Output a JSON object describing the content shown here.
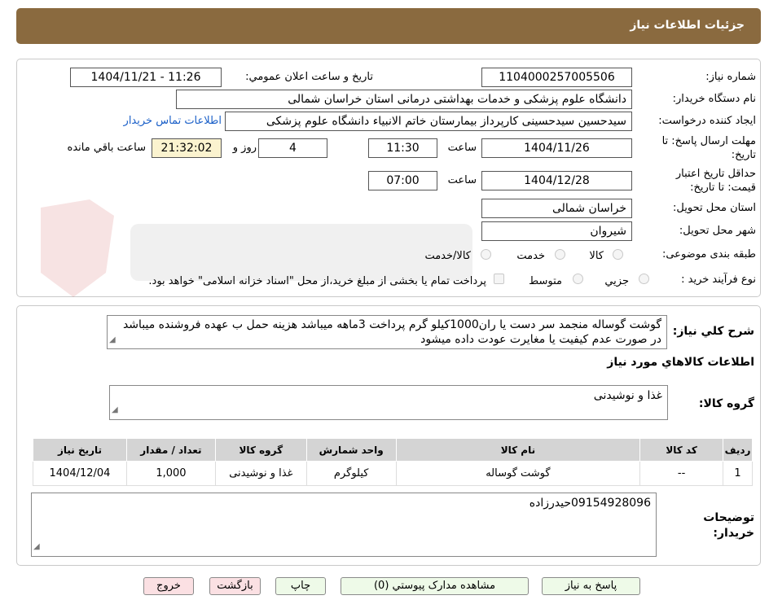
{
  "header": {
    "title": "جزئیات اطلاعات نیاز"
  },
  "form": {
    "need_number_label": "شماره نیاز:",
    "need_number": "1104000257005506",
    "announce_label": "تاریخ و ساعت اعلان عمومي:",
    "announce_value": "1404/11/21 - 11:26",
    "buyer_org_label": "نام دستگاه خریدار:",
    "buyer_org": "دانشگاه علوم پزشکی و خدمات بهداشتی درمانی استان خراسان شمالی",
    "requester_label": "ایجاد کننده درخواست:",
    "requester": "سیدحسین سیدحسینی کارپرداز بیمارستان خاتم الانبیاء دانشگاه علوم پزشکی",
    "contact_link": "اطلاعات تماس خریدار",
    "deadline_label_1": "مهلت ارسال پاسخ: تا",
    "deadline_label_2": "تاریخ:",
    "deadline_date": "1404/11/26",
    "time_label": "ساعت",
    "deadline_time": "11:30",
    "days_value": "4",
    "days_label": "روز و",
    "remaining_time": "21:32:02",
    "remaining_label": "ساعت باقي مانده",
    "validity_label_1": "حداقل تاریخ اعتبار",
    "validity_label_2": "قیمت: تا تاریخ:",
    "validity_date": "1404/12/28",
    "validity_time_label": "ساعت",
    "validity_time": "07:00",
    "province_label": "استان محل تحویل:",
    "province": "خراسان شمالی",
    "city_label": "شهر محل تحویل:",
    "city": "شیروان",
    "category_label": "طبقه بندی موضوعی:",
    "category_options": [
      "کالا",
      "خدمت",
      "کالا/خدمت"
    ],
    "process_label": "نوع فرآیند خرید :",
    "process_options": [
      "جزیي",
      "متوسط"
    ],
    "payment_note": "پرداخت تمام یا بخشی از مبلغ خرید،از محل \"اسناد خزانه اسلامی\" خواهد بود."
  },
  "description": {
    "label": "شرح کلي نياز:",
    "text": "گوشت گوساله منجمد سر دست یا ران1000کیلو گرم پرداخت 3ماهه میباشد هزینه حمل ب عهده فروشنده میباشد در صورت عدم کیفیت یا مغایرت عودت داده میشود"
  },
  "goods": {
    "title": "اطلاعات کالاهاي مورد نياز",
    "group_label": "گروه کالا:",
    "group_value": "غذا و نوشیدنی",
    "columns": [
      "رديف",
      "کد کالا",
      "نام کالا",
      "واحد شمارش",
      "گروه کالا",
      "تعداد / مقدار",
      "تاریخ نیاز"
    ],
    "rows": [
      [
        "1",
        "--",
        "گوشت گوساله",
        "کیلوگرم",
        "غذا و نوشیدنی",
        "1,000",
        "1404/12/04"
      ]
    ]
  },
  "buyer_notes": {
    "label_1": "توضیحات",
    "label_2": "خریدار:",
    "text": "09154928096حیدرزاده"
  },
  "buttons": {
    "reply": "پاسخ به نیاز",
    "view_docs": "مشاهده مدارک پیوستي (0)",
    "print": "چاپ",
    "back": "بازگشت",
    "exit": "خروج"
  },
  "colors": {
    "header_bg": "#8a6a3f",
    "green_button": "#eefae8",
    "pink_button": "#fbe0e3",
    "remaining_bg": "#fbf3cf",
    "link": "#1a5fc8"
  },
  "watermark_icon": "aria-tender-logo-icon"
}
